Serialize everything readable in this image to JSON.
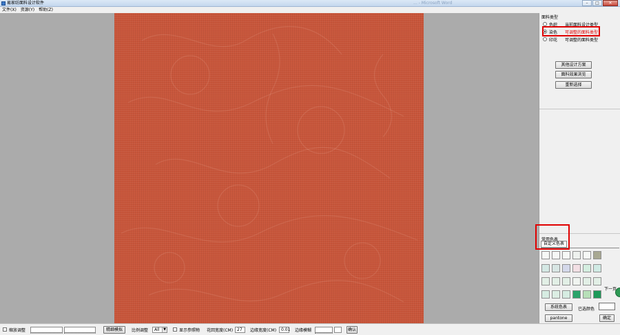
{
  "window": {
    "title": "易家纺面料设计软件",
    "background_ghost_title": "... - Microsoft Word",
    "controls": [
      "–",
      "□",
      "✕"
    ]
  },
  "menubar": {
    "items": [
      "文件(X)",
      "资源(Y)",
      "帮助(Z)"
    ]
  },
  "canvas": {
    "fabric_color": "#c8553a",
    "background_color": "#ababab"
  },
  "fabric_type": {
    "title": "面料类型",
    "options": [
      {
        "label": "色织",
        "desc": "当前面料设计类型",
        "checked": false,
        "highlight": false
      },
      {
        "label": "染色",
        "desc": "可调整的面料类型",
        "checked": true,
        "highlight": true
      },
      {
        "label": "印花",
        "desc": "可调整的面料类型",
        "checked": false,
        "highlight": false
      }
    ]
  },
  "panel_buttons": {
    "other_design": "其他设计方案",
    "fabric_preview": "面料效果浏览",
    "reselect": "重新选择"
  },
  "colors": {
    "section_title": "常用色表",
    "custom_tab": "自定义色表",
    "next_page": "下一页",
    "swatches": [
      "#f6f8f6",
      "#f6f8f6",
      "#f6f8f6",
      "#eef1ee",
      "#f6f8f6",
      "#a8a892",
      "#d4e8e4",
      "#d8e6e4",
      "#d4d8ea",
      "#f2dfe4",
      "#d4eee0",
      "#d0eae4",
      "#e2efe6",
      "#e2efe6",
      "#e2efe6",
      "#f0f4f0",
      "#e2efe6",
      "#e2efe6",
      "#d6ece2",
      "#dceee4",
      "#d6ece2",
      "#2aa36a",
      "#b7dfb8",
      "#1e9a5a"
    ],
    "system_button": "系统色表",
    "selected_label": "已选颜色",
    "pantone_button": "pantone",
    "confirm_button": "确定"
  },
  "bottombar": {
    "zoom_label": "缩放调整",
    "fine_button": "精细模拟",
    "scale_label": "比例调整",
    "scale_value": "All",
    "show_reference_label": "显示参照物",
    "pattern_width_label": "花回宽度(CM)",
    "pattern_width_value": "27",
    "border_width_label": "边缘宽度(CM)",
    "border_width_value": "0.01",
    "border_blur_label": "边缘模糊",
    "confirm_button": "确认"
  }
}
